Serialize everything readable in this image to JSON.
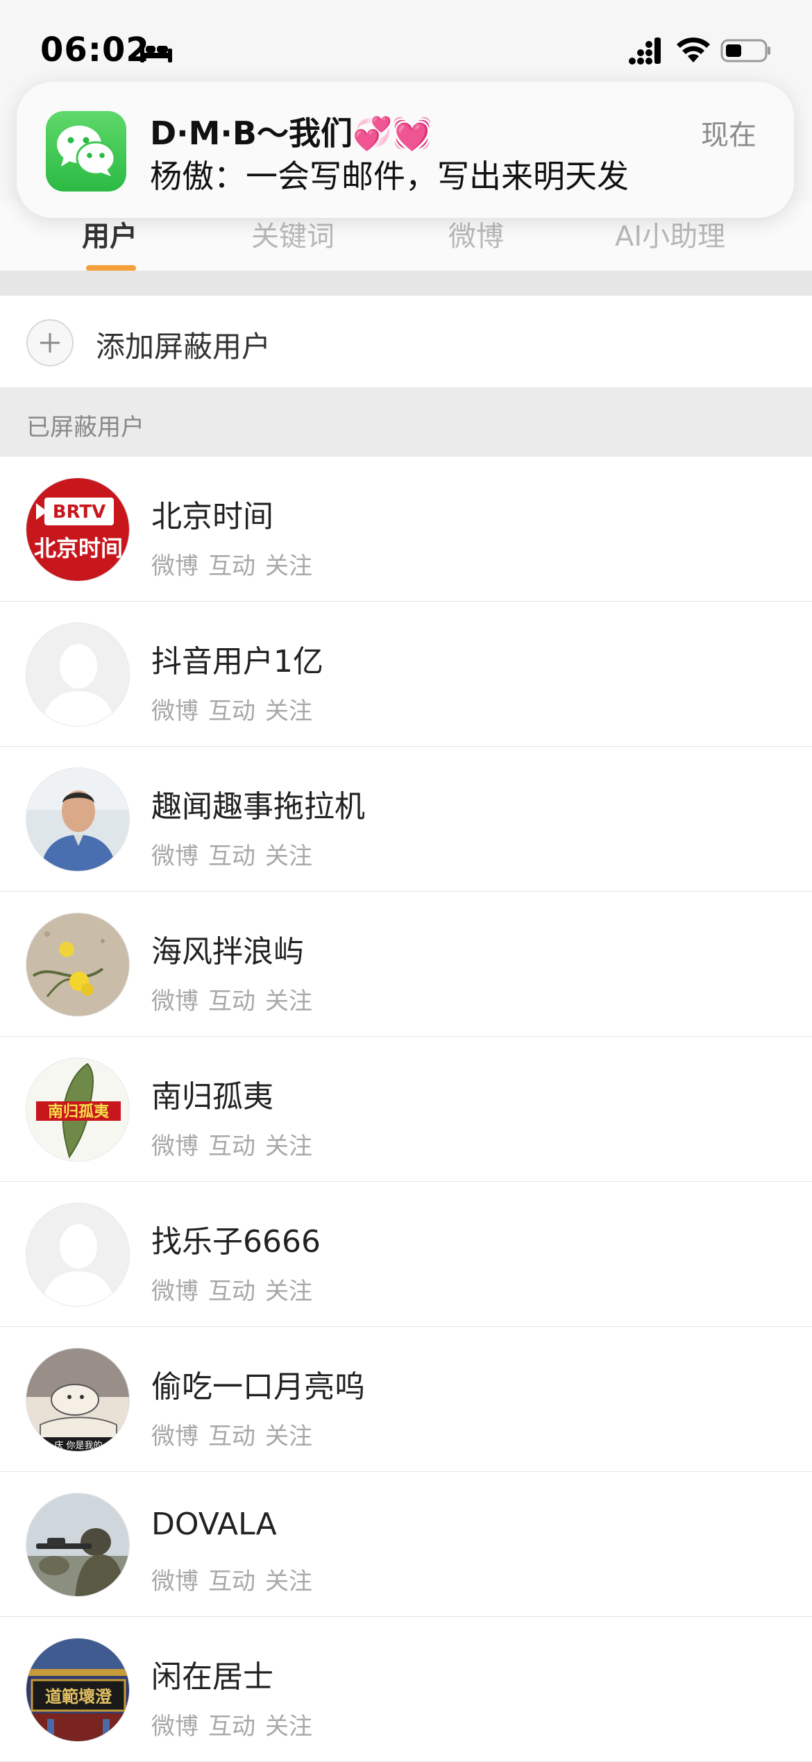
{
  "status_bar": {
    "time": "06:02"
  },
  "notification": {
    "title": "D·M·B～我们💞💓",
    "body": "杨傲：一会写邮件，写出来明天发",
    "time": "现在",
    "app_icon": "wechat-icon"
  },
  "tabs": [
    {
      "label": "用户",
      "active": true
    },
    {
      "label": "关键词",
      "active": false
    },
    {
      "label": "微博",
      "active": false
    },
    {
      "label": "AI小助理",
      "active": false
    }
  ],
  "add_blocked_user": {
    "label": "添加屏蔽用户"
  },
  "blocked_section": {
    "title": "已屏蔽用户"
  },
  "users": [
    {
      "name": "北京时间",
      "tags": [
        "微博",
        "互动",
        "关注"
      ],
      "avatar": "brtv-logo"
    },
    {
      "name": "抖音用户1亿",
      "tags": [
        "微博",
        "互动",
        "关注"
      ],
      "avatar": "default-avatar"
    },
    {
      "name": "趣闻趣事拖拉机",
      "tags": [
        "微博",
        "互动",
        "关注"
      ],
      "avatar": "person-photo"
    },
    {
      "name": "海风拌浪屿",
      "tags": [
        "微博",
        "互动",
        "关注"
      ],
      "avatar": "flowers-on-sand"
    },
    {
      "name": "南归孤夷",
      "tags": [
        "微博",
        "互动",
        "关注"
      ],
      "avatar": "island-map"
    },
    {
      "name": "找乐子6666",
      "tags": [
        "微博",
        "互动",
        "关注"
      ],
      "avatar": "default-avatar"
    },
    {
      "name": "偷吃一口月亮呜",
      "tags": [
        "微博",
        "互动",
        "关注"
      ],
      "avatar": "cartoon-bed"
    },
    {
      "name": "DOVALA",
      "tags": [
        "微博",
        "互动",
        "关注"
      ],
      "avatar": "soldiers-photo"
    },
    {
      "name": "闲在居士",
      "tags": [
        "微博",
        "互动",
        "关注"
      ],
      "avatar": "temple-plaque"
    }
  ],
  "avatar_texts": {
    "brtv_top": "BRTV",
    "brtv_bottom": "北京时间",
    "island_label": "南归孤夷",
    "cartoon_caption": "庆 你是我的",
    "temple_text": "道範壞澄"
  },
  "colors": {
    "tab_active_underline": "#f5a03c",
    "wechat_green": "#2bba44",
    "brtv_red": "#c8161d"
  }
}
